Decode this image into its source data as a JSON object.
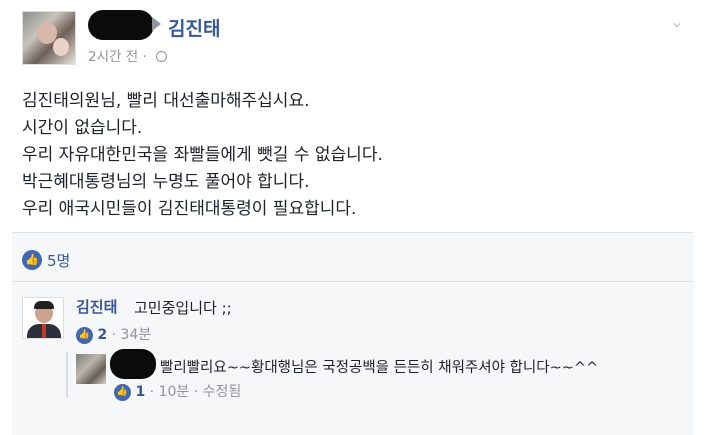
{
  "post": {
    "author": "김진태",
    "time": "2시간 전",
    "separator": "·",
    "lines": [
      "김진태의원님, 빨리 대선출마해주십시요.",
      "시간이 없습니다.",
      "우리 자유대한민국을 좌빨들에게 뺏길 수 없습니다.",
      "박근혜대통령님의 누명도 풀어야 합니다.",
      "우리 애국시민들이 김진태대통령이 필요합니다."
    ],
    "like_count": "5명"
  },
  "comment": {
    "author": "김진태",
    "text": "고민중입니다 ;;",
    "likes": "2",
    "time": "· 34분"
  },
  "reply": {
    "text": "빨리빨리요~~황대행님은 국정공백을 든든히 채워주셔야 합니다~~^^",
    "likes": "1",
    "time": "· 10분 · 수정됨"
  },
  "icons": {
    "globe": "globe-icon",
    "chevron": "chevron-down-icon",
    "like": "thumbs-up-icon"
  },
  "colors": {
    "link": "#365899",
    "like_blue": "#4267b2",
    "meta_gray": "#90949c"
  }
}
